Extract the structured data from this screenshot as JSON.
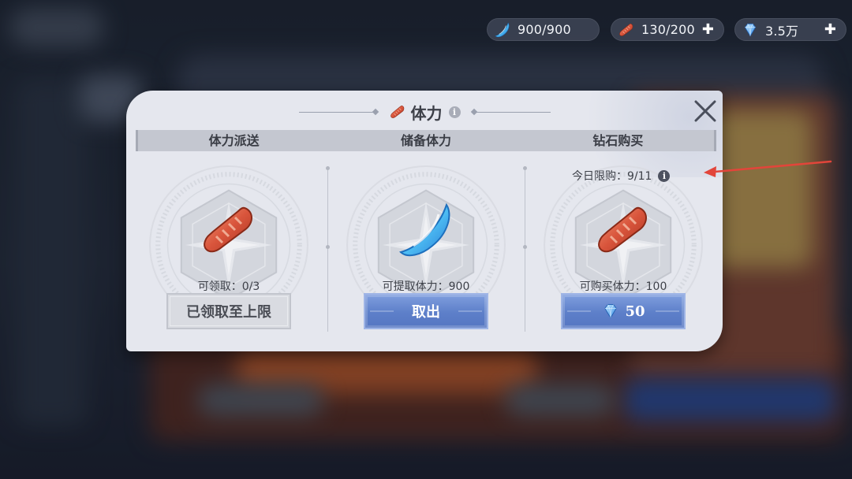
{
  "resources": [
    {
      "icon": "stamina-crystal-icon",
      "value": "900/900",
      "has_plus": false
    },
    {
      "icon": "sausage-icon",
      "value": "130/200",
      "has_plus": true
    },
    {
      "icon": "diamond-icon",
      "value": "3.5万",
      "has_plus": true
    }
  ],
  "dialog": {
    "title": "体力",
    "columns": [
      {
        "header": "体力派送",
        "stat": "可领取：0/3",
        "button": "已领取至上限",
        "button_state": "disabled",
        "item_icon": "sausage-icon"
      },
      {
        "header": "储备体力",
        "stat": "可提取体力：900",
        "button": "取出",
        "button_state": "active",
        "item_icon": "stamina-crystal-icon"
      },
      {
        "header": "钻石购买",
        "stat": "可购买体力：100",
        "button": "50",
        "button_state": "active",
        "item_icon": "sausage-icon",
        "button_icon": "diamond-icon"
      }
    ],
    "daily_limit": "今日限购：9/11"
  },
  "colors": {
    "panel_bg": "#e5e7ee",
    "button_blue": "#5d7fc9",
    "annotation_arrow": "#e2453a"
  }
}
